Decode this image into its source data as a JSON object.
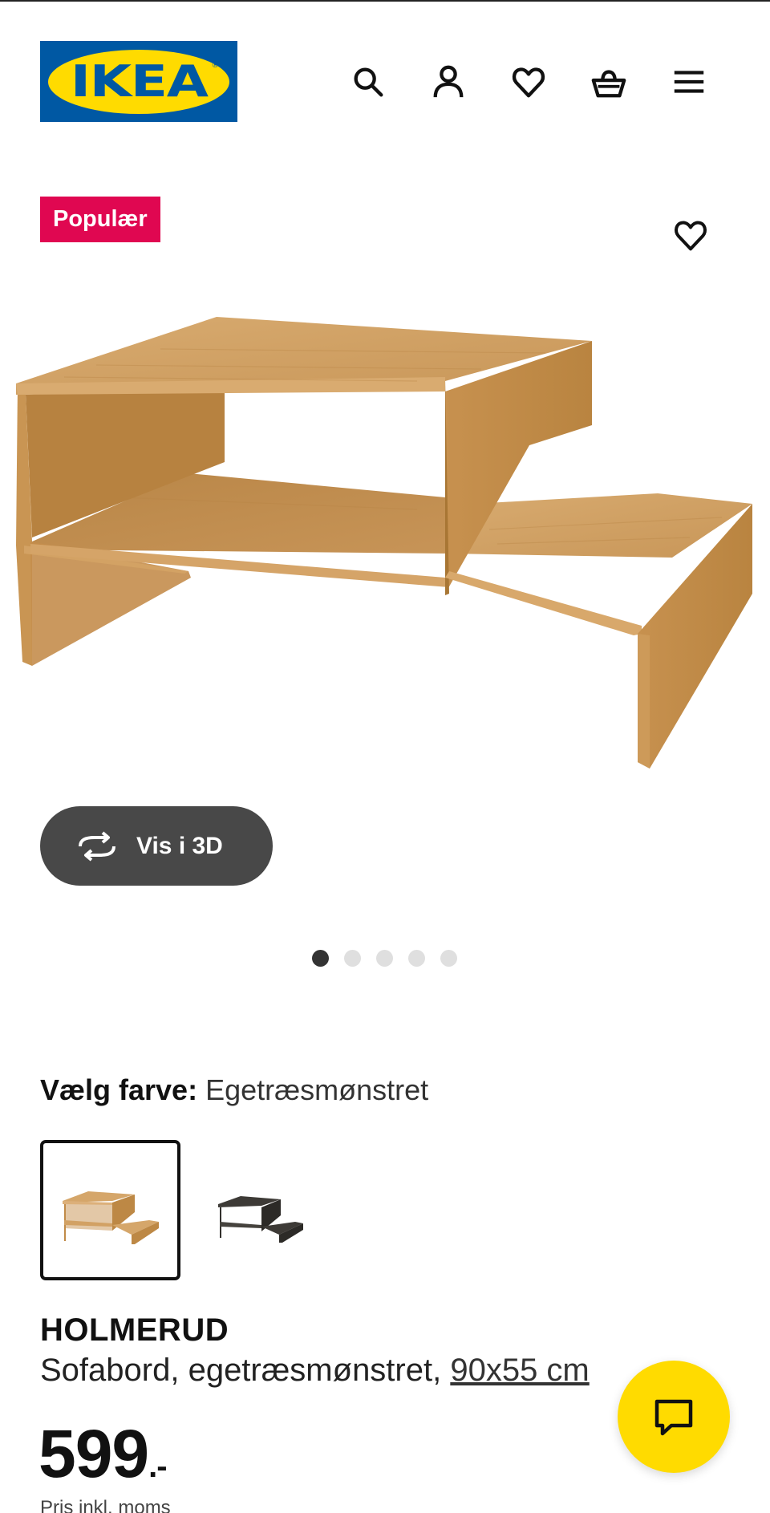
{
  "header": {
    "logo_text": "IKEA",
    "logo_registered": "®",
    "icons": [
      "search-icon",
      "user-icon",
      "heart-icon",
      "basket-icon",
      "menu-icon"
    ]
  },
  "product": {
    "badge": "Populær",
    "view_3d_label": "Vis i 3D",
    "gallery": {
      "total": 5,
      "active": 1
    },
    "color_label": "Vælg farve:",
    "color_value": "Egetræsmønstret",
    "swatches": [
      "oak",
      "black-brown"
    ],
    "name": "HOLMERUD",
    "description": "Sofabord, egetræsmønstret, ",
    "size_link": "90x55 cm",
    "price_int": "599",
    "price_suffix": ".-",
    "price_note": "Pris inkl. moms"
  },
  "colors": {
    "ikea_blue": "#0058a3",
    "ikea_yellow": "#ffdb00",
    "badge_red": "#e00751",
    "button_dark": "#484848"
  }
}
